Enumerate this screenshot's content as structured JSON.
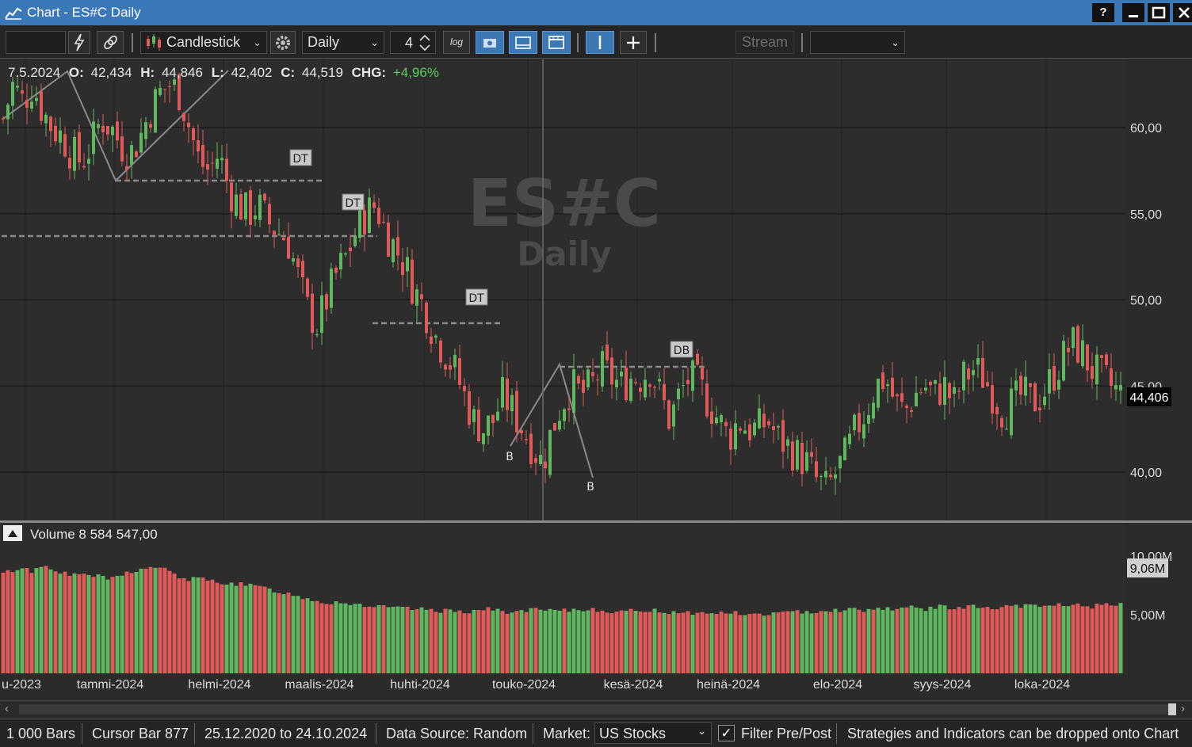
{
  "window": {
    "title": "Chart - ES#C Daily"
  },
  "window_buttons": {
    "help": "?",
    "minimize": "—",
    "maximize": "▢",
    "close": "✕"
  },
  "toolbar": {
    "symbol_value": "",
    "chart_style": "Candlestick",
    "interval": "Daily",
    "interval_count": "4",
    "log_label": "log",
    "stream_label": "Stream",
    "data_field_value": ""
  },
  "watermark": {
    "symbol": "ES#C",
    "interval": "Daily"
  },
  "info_line": {
    "date": "7.5.2024",
    "o_label": "O:",
    "o_value": "42,434",
    "h_label": "H:",
    "h_value": "44,846",
    "l_label": "L:",
    "l_value": "42,402",
    "c_label": "C:",
    "c_value": "44,519",
    "chg_label": "CHG:",
    "chg_value": "+4,96%"
  },
  "volume_panel": {
    "label": "Volume 8 584 547,00",
    "current_value": "9,06M"
  },
  "price_badge": "44,406",
  "pattern_labels": [
    "DT",
    "DT",
    "DT",
    "DB",
    "B",
    "B"
  ],
  "colors": {
    "up": "#5fb85f",
    "down": "#e05a5a",
    "background": "#2b2b2b",
    "titlebar": "#3b78b8",
    "chg_positive": "#55d155"
  },
  "chart_data": {
    "type": "candlestick",
    "price_axis": {
      "ticks": [
        40,
        45,
        50,
        55,
        60
      ],
      "tick_labels": [
        "40,00",
        "45,00",
        "50,00",
        "55,00",
        "60,00"
      ],
      "range": [
        37.5,
        63.5
      ]
    },
    "volume_axis": {
      "ticks": [
        5000000,
        10000000
      ],
      "tick_labels": [
        "5,00M",
        "10,00M"
      ]
    },
    "x_labels": [
      "u-2023",
      "tammi-2024",
      "helmi-2024",
      "maalis-2024",
      "huhti-2024",
      "touko-2024",
      "kesä-2024",
      "heinä-2024",
      "elo-2024",
      "syys-2024",
      "loka-2024"
    ],
    "close_path": [
      60.5,
      62.5,
      61.5,
      62.5,
      61.0,
      60.0,
      59.5,
      58.5,
      58.0,
      59.0,
      60.5,
      60.0,
      59.0,
      58.5,
      59.5,
      61.0,
      62.0,
      62.5,
      62.0,
      60.0,
      58.0,
      57.5,
      58.5,
      56.5,
      55.5,
      55.0,
      55.5,
      54.5,
      54.0,
      53.5,
      51.5,
      49.5,
      48.5,
      50.0,
      51.5,
      52.5,
      54.0,
      55.0,
      55.5,
      54.0,
      53.0,
      52.0,
      50.5,
      49.5,
      48.0,
      47.0,
      46.0,
      44.5,
      43.0,
      42.5,
      43.0,
      44.5,
      43.5,
      42.5,
      41.5,
      40.5,
      42.5,
      44.0,
      45.0,
      44.5,
      45.0,
      46.0,
      45.5,
      45.0,
      45.5,
      45.5,
      46.0,
      44.5,
      43.0,
      44.5,
      45.5,
      45.0,
      44.0,
      43.0,
      42.0,
      43.0,
      42.5,
      42.5,
      43.0,
      42.0,
      41.5,
      41.0,
      40.5,
      39.5,
      39.0,
      40.0,
      41.0,
      42.5,
      43.5,
      45.0,
      45.5,
      44.0,
      43.5,
      44.5,
      45.0,
      44.5,
      45.0,
      44.0,
      45.5,
      46.0,
      45.5,
      44.5,
      43.5,
      44.0,
      44.5,
      44.0,
      44.5,
      45.5,
      46.5,
      47.5,
      47.0,
      46.0,
      45.5,
      45.0,
      44.5
    ],
    "volume_path": [
      8.5,
      8.8,
      9.0,
      8.7,
      9.2,
      9.0,
      8.6,
      8.3,
      8.5,
      8.4,
      8.2,
      8.0,
      8.4,
      8.7,
      8.8,
      9.0,
      9.1,
      8.6,
      8.2,
      8.0,
      8.1,
      7.9,
      7.8,
      7.7,
      7.6,
      7.5,
      7.4,
      7.2,
      7.0,
      6.8,
      6.6,
      6.4,
      6.2,
      6.0,
      6.1,
      6.0,
      5.9,
      5.8,
      5.7,
      5.6,
      5.6,
      5.5,
      5.5,
      5.4,
      5.4,
      5.3,
      5.4,
      5.3,
      5.3,
      5.5,
      5.4,
      5.3,
      5.2,
      5.3,
      5.4,
      5.4,
      5.3,
      5.3,
      5.4,
      5.4,
      5.5,
      5.4,
      5.3,
      5.2,
      5.3,
      5.4,
      5.4,
      5.3,
      5.2,
      5.3,
      5.2,
      5.1,
      5.1,
      5.2,
      5.2,
      5.1,
      5.0,
      5.0,
      5.1,
      5.1,
      5.2,
      5.2,
      5.3,
      5.3,
      5.4,
      5.4,
      5.4,
      5.5,
      5.4,
      5.5,
      5.6,
      5.5,
      5.6,
      5.6,
      5.5,
      5.6,
      5.7,
      5.6,
      5.6,
      5.7,
      5.6,
      5.5,
      5.6,
      5.7,
      5.7,
      5.8,
      5.7,
      5.8,
      5.9,
      5.8,
      5.8,
      5.7,
      5.8,
      5.8,
      5.8
    ]
  },
  "statusbar": {
    "bars": "1 000 Bars",
    "cursor_bar": "Cursor Bar 877",
    "date_range": "25.12.2020 to 24.10.2024",
    "data_source": "Data Source: Random",
    "market_label": "Market:",
    "market_value": "US Stocks",
    "filter_label": "Filter Pre/Post",
    "hint": "Strategies and Indicators can be dropped onto Chart"
  }
}
